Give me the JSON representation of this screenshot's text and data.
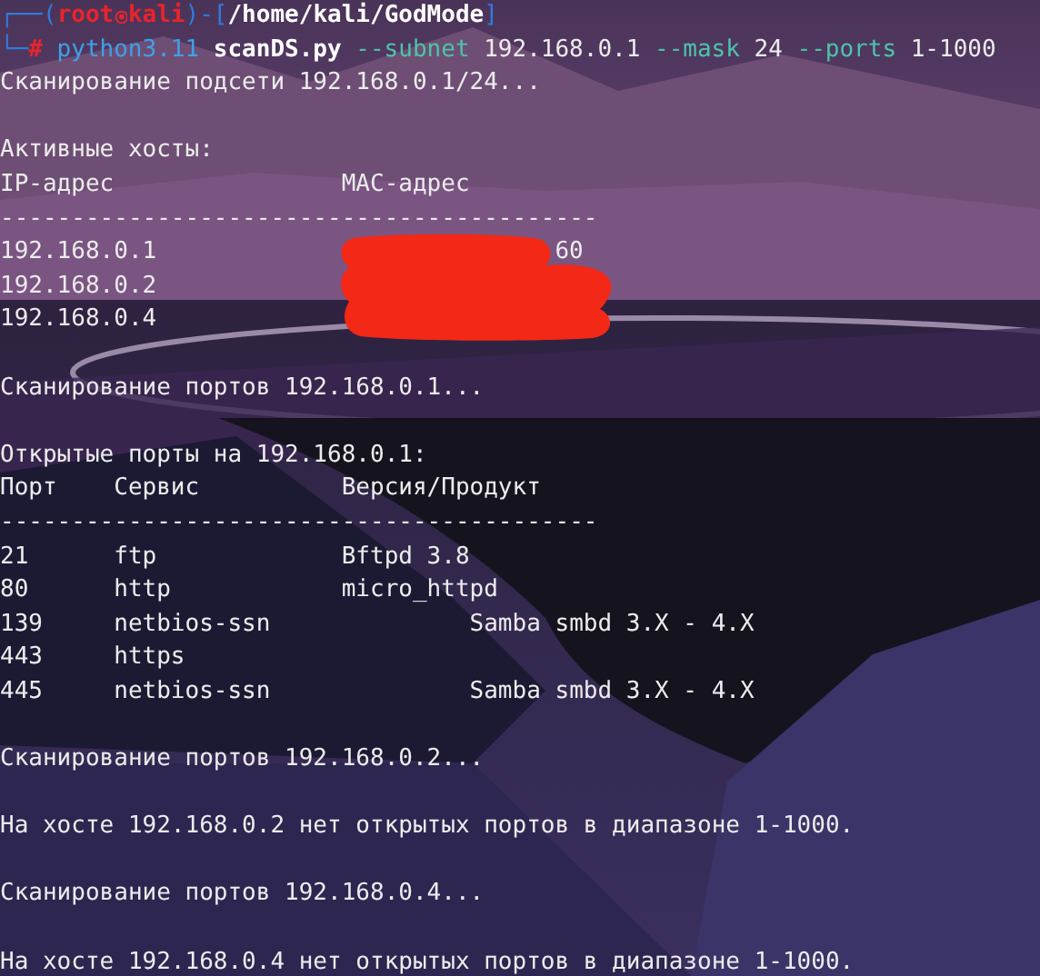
{
  "prompt": [
    {
      "kind": "frame",
      "text": "┌──("
    },
    {
      "kind": "user",
      "text": "root"
    },
    {
      "kind": "at"
    },
    {
      "kind": "user",
      "text": "kali"
    },
    {
      "kind": "frame",
      "text": ")-["
    },
    {
      "kind": "path",
      "text": "/home/kali/GodMode"
    },
    {
      "kind": "frame",
      "text": "]"
    }
  ],
  "command": [
    {
      "kind": "frame",
      "text": "└─"
    },
    {
      "kind": "symbol",
      "text": "#"
    },
    {
      "kind": "program",
      "text": "python3.11"
    },
    {
      "kind": "file",
      "text": "scanDS.py"
    },
    {
      "kind": "option",
      "text": "--subnet"
    },
    {
      "kind": "value",
      "text": "192.168.0.1"
    },
    {
      "kind": "option",
      "text": "--mask"
    },
    {
      "kind": "value",
      "text": "24"
    },
    {
      "kind": "option",
      "text": "--ports"
    },
    {
      "kind": "value",
      "text": "1-1000"
    }
  ],
  "output": [
    {
      "kind": "text",
      "text": "Сканирование подсети 192.168.0.1/24..."
    },
    {
      "kind": "blank"
    },
    {
      "kind": "text",
      "text": "Активные хосты:"
    },
    {
      "kind": "text",
      "text": "IP-адрес                MAC-адрес"
    },
    {
      "kind": "text",
      "text": "------------------------------------------"
    },
    {
      "kind": "host",
      "ip": "192.168.0.1",
      "mac": "60"
    },
    {
      "kind": "host",
      "ip": "192.168.0.2"
    },
    {
      "kind": "host",
      "ip": "192.168.0.4"
    },
    {
      "kind": "blank"
    },
    {
      "kind": "text",
      "text": "Сканирование портов 192.168.0.1..."
    },
    {
      "kind": "blank"
    },
    {
      "kind": "text",
      "text": "Открытые порты на 192.168.0.1:"
    },
    {
      "kind": "text",
      "text": "Порт    Сервис          Версия/Продукт"
    },
    {
      "kind": "text",
      "text": "------------------------------------------"
    },
    {
      "kind": "text",
      "text": "21      ftp             Bftpd 3.8"
    },
    {
      "kind": "text",
      "text": "80      http            micro_httpd"
    },
    {
      "kind": "text",
      "text": "139     netbios-ssn              Samba smbd 3.X - 4.X"
    },
    {
      "kind": "text",
      "text": "443     https"
    },
    {
      "kind": "text",
      "text": "445     netbios-ssn              Samba smbd 3.X - 4.X"
    },
    {
      "kind": "blank"
    },
    {
      "kind": "text",
      "text": "Сканирование портов 192.168.0.2..."
    },
    {
      "kind": "blank"
    },
    {
      "kind": "text",
      "text": "На хосте 192.168.0.2 нет открытых портов в диапазоне 1-1000."
    },
    {
      "kind": "blank"
    },
    {
      "kind": "text",
      "text": "Сканирование портов 192.168.0.4..."
    },
    {
      "kind": "blank"
    },
    {
      "kind": "text",
      "text": "На хосте 192.168.0.4 нет открытых портов в диапазоне 1-1000."
    }
  ]
}
